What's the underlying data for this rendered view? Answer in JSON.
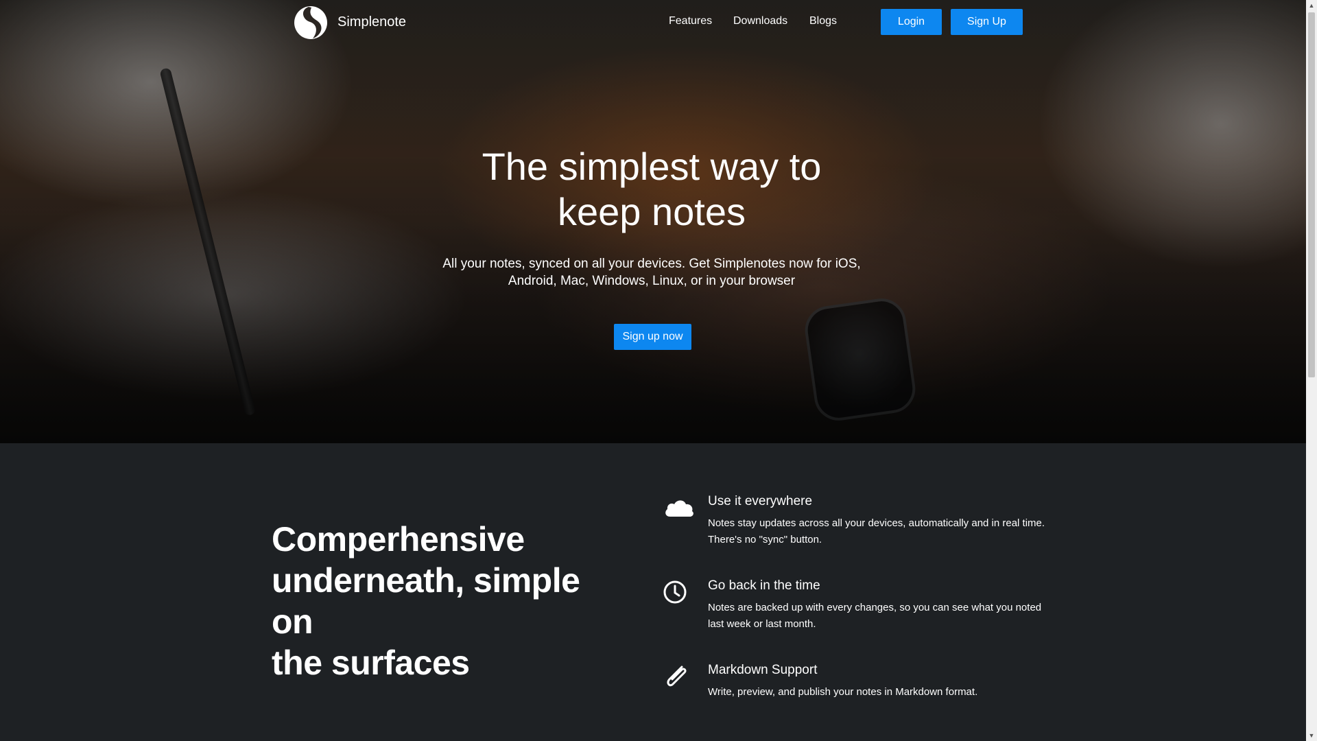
{
  "nav": {
    "brand": "Simplenote",
    "links": [
      "Features",
      "Downloads",
      "Blogs"
    ],
    "login_label": "Login",
    "signup_label": "Sign Up"
  },
  "hero": {
    "title_line1": "The simplest way to",
    "title_line2": "keep notes",
    "subtitle_line1": "All your notes, synced on all your devices. Get Simplenotes now for iOS,",
    "subtitle_line2": "Android, Mac, Windows, Linux, or in your browser",
    "cta_label": "Sign up now"
  },
  "features": {
    "heading_line1": "Comperhensive",
    "heading_line2": "underneath, simple on",
    "heading_line3": "the surfaces",
    "items": [
      {
        "icon": "cloud-icon",
        "title": "Use it everywhere",
        "desc": "Notes stay updates across all your devices, automatically and in real time. There's no \"sync\" button."
      },
      {
        "icon": "clock-icon",
        "title": "Go back in the time",
        "desc": "Notes are backed up with every changes, so you can see what you noted last week or last month."
      },
      {
        "icon": "paperclip-icon",
        "title": "Markdown Support",
        "desc": "Write, preview, and publish your notes in Markdown format."
      }
    ]
  },
  "colors": {
    "accent": "#0d87f0",
    "section_bg": "#1e2124"
  }
}
